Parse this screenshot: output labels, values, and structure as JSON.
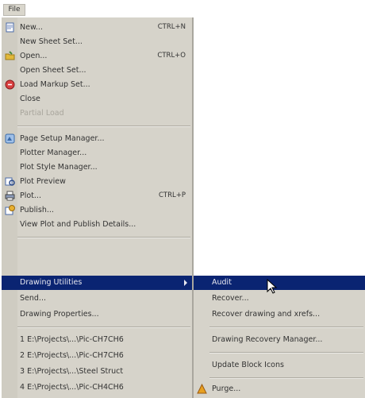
{
  "menubar": {
    "title": "File"
  },
  "menu": {
    "new": {
      "label": "New...",
      "shortcut": "CTRL+N"
    },
    "new_sheet_set": {
      "label": "New Sheet Set..."
    },
    "open": {
      "label": "Open...",
      "shortcut": "CTRL+O"
    },
    "open_sheet_set": {
      "label": "Open Sheet Set..."
    },
    "load_markup_set": {
      "label": "Load Markup Set..."
    },
    "close": {
      "label": "Close"
    },
    "partial_load": {
      "label": "Partial Load"
    },
    "page_setup_manager": {
      "label": "Page Setup Manager..."
    },
    "plotter_manager": {
      "label": "Plotter Manager..."
    },
    "plot_style_manager": {
      "label": "Plot Style Manager..."
    },
    "plot_preview": {
      "label": "Plot Preview"
    },
    "plot": {
      "label": "Plot...",
      "shortcut": "CTRL+P"
    },
    "publish": {
      "label": "Publish..."
    },
    "view_plot_details": {
      "label": "View Plot and Publish Details..."
    },
    "drawing_utilities": {
      "label": "Drawing Utilities"
    },
    "send": {
      "label": "Send..."
    },
    "drawing_properties": {
      "label": "Drawing Properties..."
    },
    "recent": [
      {
        "label": "1 E:\\Projects\\...\\Pic-CH7CH6"
      },
      {
        "label": "2 E:\\Projects\\...\\Pic-CH7CH6"
      },
      {
        "label": "3 E:\\Projects\\...\\Steel Struct"
      },
      {
        "label": "4 E:\\Projects\\...\\Pic-CH4CH6"
      }
    ]
  },
  "submenu": {
    "audit": {
      "label": "Audit"
    },
    "recover": {
      "label": "Recover..."
    },
    "recover_xrefs": {
      "label": "Recover drawing and xrefs..."
    },
    "drawing_recovery_manager": {
      "label": "Drawing Recovery Manager..."
    },
    "update_block_icons": {
      "label": "Update Block Icons"
    },
    "purge": {
      "label": "Purge..."
    }
  },
  "colors": {
    "menu_bg": "#d6d3ca",
    "highlight": "#0a2472",
    "highlight_text": "#e8e8f0"
  }
}
